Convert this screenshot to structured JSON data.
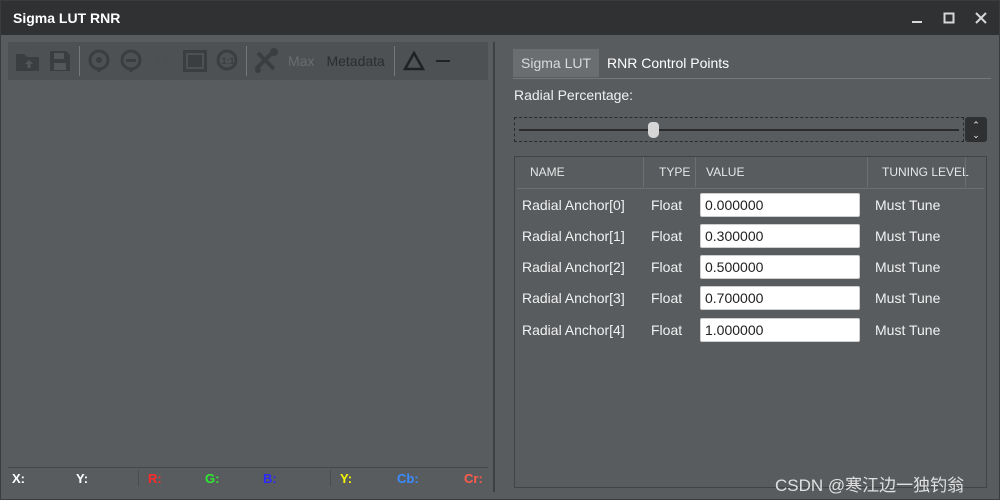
{
  "window": {
    "title": "Sigma LUT RNR"
  },
  "toolbar": {
    "max_label": "Max",
    "metadata_label": "Metadata"
  },
  "status": {
    "x": "X:",
    "y": "Y:",
    "r": "R:",
    "g": "G:",
    "b": "B:",
    "yy": "Y:",
    "cb": "Cb:",
    "cr": "Cr:",
    "colors": {
      "r": "#ff2a2a",
      "g": "#2eea2e",
      "b": "#2a2aff",
      "yy": "#f6f600",
      "cb": "#3a8cff",
      "cr": "#ff5a4a"
    }
  },
  "tabs": [
    {
      "label": "Sigma LUT",
      "active": true
    },
    {
      "label": "RNR Control Points",
      "active": false
    }
  ],
  "radial": {
    "label": "Radial Percentage:",
    "value": 0.3
  },
  "table": {
    "headers": {
      "name": "NAME",
      "type": "TYPE",
      "value": "VALUE",
      "tuning": "TUNING LEVEL"
    },
    "rows": [
      {
        "name": "Radial Anchor[0]",
        "type": "Float",
        "value": "0.000000",
        "tuning": "Must Tune"
      },
      {
        "name": "Radial Anchor[1]",
        "type": "Float",
        "value": "0.300000",
        "tuning": "Must Tune"
      },
      {
        "name": "Radial Anchor[2]",
        "type": "Float",
        "value": "0.500000",
        "tuning": "Must Tune"
      },
      {
        "name": "Radial Anchor[3]",
        "type": "Float",
        "value": "0.700000",
        "tuning": "Must Tune"
      },
      {
        "name": "Radial Anchor[4]",
        "type": "Float",
        "value": "1.000000",
        "tuning": "Must Tune"
      }
    ]
  },
  "watermark": "CSDN @寒江边一独钓翁"
}
